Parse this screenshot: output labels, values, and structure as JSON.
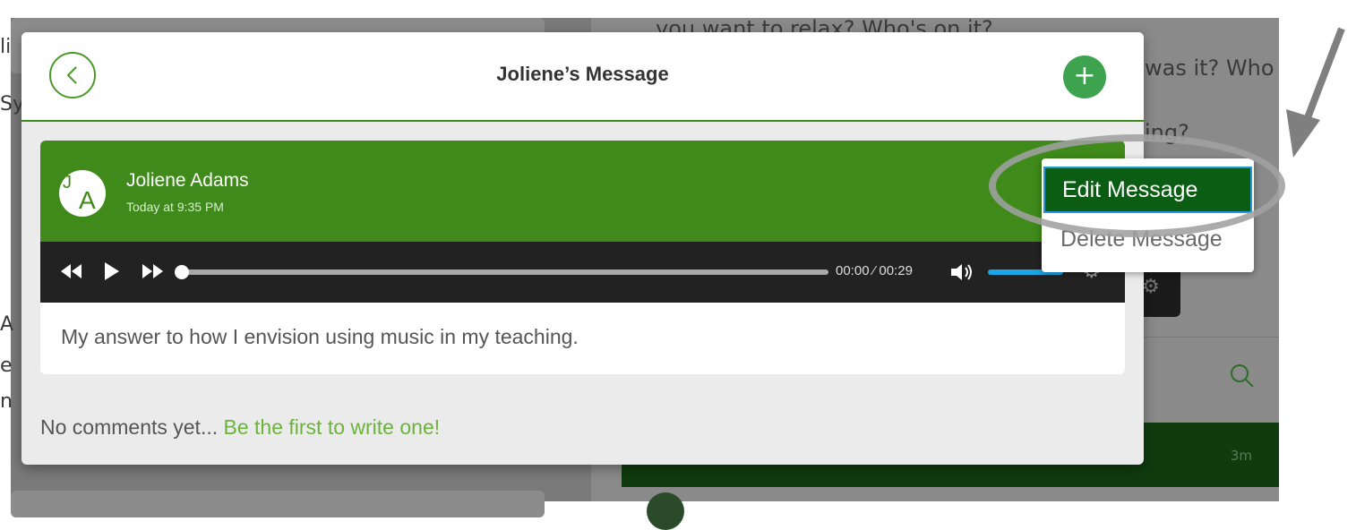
{
  "background": {
    "text_lines": [
      "you want to relax? Who's on it?",
      "was it? Who",
      "ing?"
    ],
    "row_time": "3m",
    "left_edge_texts": [
      "li",
      "Sy",
      "A",
      "e",
      "n"
    ]
  },
  "modal": {
    "title": "Joliene’s Message",
    "add_label": "+",
    "author": "Joliene Adams",
    "timestamp": "Today at 9:35 PM",
    "avatar_initials": {
      "first": "J",
      "last": "A"
    },
    "player": {
      "time": "00:00 ⁄ 00:29",
      "progress": 0.0,
      "volume": 0.8
    },
    "caption": "My answer to how I envision using music in my teaching.",
    "comments_text": "No comments yet...",
    "comments_link": "Be the first to write one!"
  },
  "menu": {
    "edit_label": "Edit Message",
    "delete_label": "Delete Message"
  },
  "colors": {
    "brand_green": "#3f8a1b",
    "menu_active": "#0a5d12",
    "focus_border": "#1f9cd8",
    "link": "#6bb33a"
  }
}
